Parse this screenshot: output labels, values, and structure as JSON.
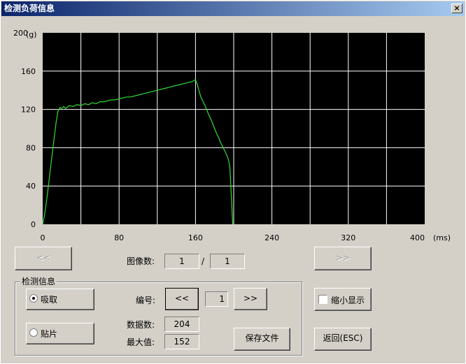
{
  "window": {
    "title": "检测负荷信息",
    "close_label": "×"
  },
  "chart_data": {
    "type": "line",
    "yunit": "(g)",
    "xunit": "(ms)",
    "xlim": [
      0,
      400
    ],
    "ylim": [
      0,
      200
    ],
    "xticks": [
      "0",
      "80",
      "160",
      "240",
      "320",
      "400"
    ],
    "yticks": [
      "200",
      "160",
      "120",
      "80",
      "40",
      "0"
    ],
    "grid": true,
    "background": "#000000",
    "line_color": "#33dd33",
    "grid_color": "#ffffff",
    "series": [
      {
        "x": [
          0,
          2,
          4,
          6,
          8,
          10,
          12,
          14,
          16,
          18,
          20,
          22,
          24,
          28,
          32,
          36,
          40,
          44,
          48,
          52,
          56,
          60,
          64,
          68,
          72,
          76,
          80,
          84,
          88,
          92,
          96,
          100,
          104,
          108,
          112,
          116,
          120,
          124,
          128,
          132,
          136,
          140,
          144,
          148,
          152,
          156,
          158,
          160,
          162,
          164,
          166,
          168,
          170,
          172,
          174,
          176,
          178,
          180,
          182,
          184,
          186,
          188,
          190,
          192,
          194,
          195,
          196,
          197,
          198,
          198.5,
          199
        ],
        "values": [
          0,
          10,
          24,
          40,
          57,
          74,
          90,
          106,
          118,
          122,
          121,
          123,
          121,
          124,
          123,
          125,
          124,
          126,
          125,
          127,
          126,
          128,
          128,
          129,
          130,
          130,
          131,
          132,
          133,
          133,
          134,
          135,
          136,
          137,
          138,
          139,
          140,
          141,
          142,
          143,
          144,
          145,
          146,
          147,
          148,
          149,
          150,
          151,
          146,
          138,
          132,
          128,
          124,
          119,
          114,
          110,
          105,
          100,
          95,
          91,
          86,
          82,
          78,
          74,
          69,
          65,
          60,
          40,
          20,
          8,
          0
        ]
      }
    ]
  },
  "nav": {
    "prev_label": "<<",
    "next_label": ">>"
  },
  "image_count": {
    "label": "图像数:",
    "current": "1",
    "separator": "/",
    "total": "1"
  },
  "detect_info": {
    "group_title": "检测信息",
    "radio_suck": "吸取",
    "radio_paste": "贴片",
    "number_label": "编号:",
    "number_prev": "<<",
    "number_value": "1",
    "number_next": ">>",
    "data_count_label": "数据数:",
    "data_count_value": "204",
    "max_label": "最大值:",
    "max_value": "152",
    "save_label": "保存文件"
  },
  "shrink_label": "缩小显示",
  "return_label": "返回(ESC)"
}
